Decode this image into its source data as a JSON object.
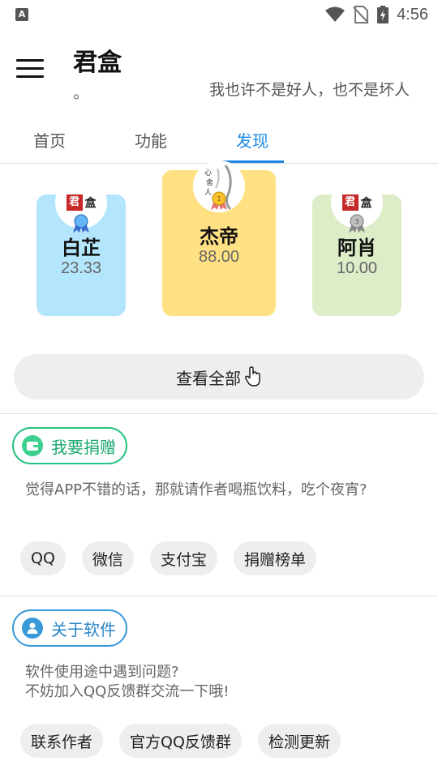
{
  "status_bar": {
    "left_icon": "A",
    "time": "4:56",
    "icons": [
      "wifi-icon",
      "no-sim-icon",
      "battery-charging-icon"
    ]
  },
  "header": {
    "title": "君盒",
    "subtitle": "。",
    "marquee": "我也许不是好人，也不是坏人"
  },
  "tabs": [
    {
      "label": "首页",
      "active": false
    },
    {
      "label": "功能",
      "active": false
    },
    {
      "label": "发现",
      "active": true
    }
  ],
  "ranking": [
    {
      "rank": 2,
      "name": "白芷",
      "amount": "23.33",
      "color": "#b3e5fc",
      "medal": "silver-blue"
    },
    {
      "rank": 1,
      "name": "杰帝",
      "amount": "88.00",
      "color": "#ffe082",
      "medal": "gold"
    },
    {
      "rank": 3,
      "name": "阿肖",
      "amount": "10.00",
      "color": "#dcedc8",
      "medal": "gray"
    }
  ],
  "view_all": {
    "label": "查看全部",
    "icon": "hand-pointer-icon"
  },
  "donate": {
    "title": "我要捐赠",
    "icon": "wallet-icon",
    "accent": "#26c281",
    "description": "觉得APP不错的话，那就请作者喝瓶饮料，吃个夜宵?",
    "buttons": [
      "QQ",
      "微信",
      "支付宝",
      "捐赠榜单"
    ]
  },
  "about": {
    "title": "关于软件",
    "icon": "user-icon",
    "accent": "#3a9ad9",
    "description_line1": "软件使用途中遇到问题?",
    "description_line2": "不妨加入QQ反馈群交流一下哦!",
    "buttons": [
      "联系作者",
      "官方QQ反馈群",
      "检测更新"
    ]
  }
}
